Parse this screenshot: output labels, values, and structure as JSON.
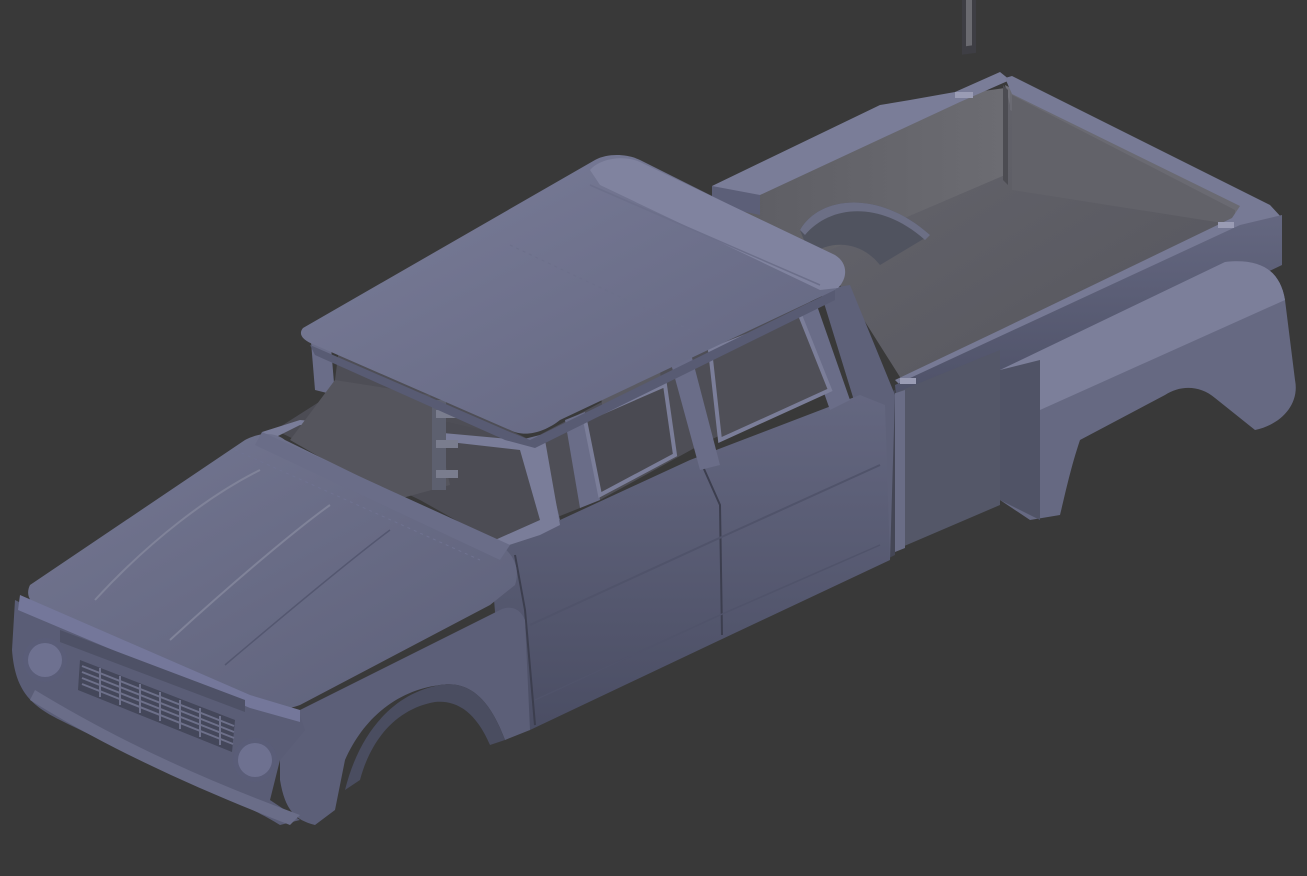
{
  "viewport": {
    "background_color": "#393939",
    "model": {
      "name": "pickup-truck-body",
      "body_color": "#5c5f78",
      "body_light_color": "#6f7290",
      "body_shadow_color": "#43465a",
      "interior_color": "#53535a",
      "bed_floor_color": "#5e5e66"
    }
  }
}
